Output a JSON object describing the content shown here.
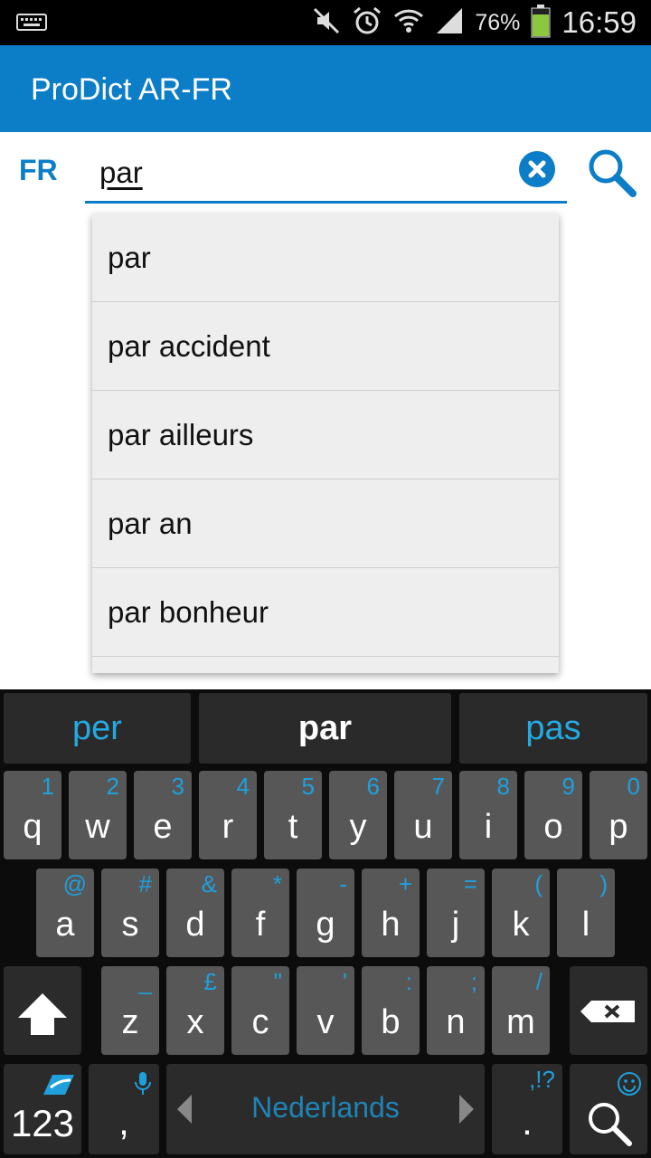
{
  "status_bar": {
    "battery_percent": "76%",
    "time": "16:59"
  },
  "app": {
    "title": "ProDict AR-FR"
  },
  "search": {
    "language": "FR",
    "value": "par"
  },
  "suggestions_dropdown": [
    "par",
    "par accident",
    "par ailleurs",
    "par an",
    "par bonheur"
  ],
  "keyboard": {
    "word_suggestions": {
      "left": "per",
      "center": "par",
      "right": "pas"
    },
    "row1": [
      {
        "key": "q",
        "hint": "1"
      },
      {
        "key": "w",
        "hint": "2"
      },
      {
        "key": "e",
        "hint": "3"
      },
      {
        "key": "r",
        "hint": "4"
      },
      {
        "key": "t",
        "hint": "5"
      },
      {
        "key": "y",
        "hint": "6"
      },
      {
        "key": "u",
        "hint": "7"
      },
      {
        "key": "i",
        "hint": "8"
      },
      {
        "key": "o",
        "hint": "9"
      },
      {
        "key": "p",
        "hint": "0"
      }
    ],
    "row2": [
      {
        "key": "a",
        "hint": "@"
      },
      {
        "key": "s",
        "hint": "#"
      },
      {
        "key": "d",
        "hint": "&"
      },
      {
        "key": "f",
        "hint": "*"
      },
      {
        "key": "g",
        "hint": "-"
      },
      {
        "key": "h",
        "hint": "+"
      },
      {
        "key": "j",
        "hint": "="
      },
      {
        "key": "k",
        "hint": "("
      },
      {
        "key": "l",
        "hint": ")"
      }
    ],
    "row3": [
      {
        "key": "z",
        "hint": "_"
      },
      {
        "key": "x",
        "hint": "£"
      },
      {
        "key": "c",
        "hint": "\""
      },
      {
        "key": "v",
        "hint": "'"
      },
      {
        "key": "b",
        "hint": ":"
      },
      {
        "key": "n",
        "hint": ";"
      },
      {
        "key": "m",
        "hint": "/"
      }
    ],
    "numbers_key": "123",
    "comma_key": ",",
    "space_language": "Nederlands",
    "period_key": ".",
    "period_hint": ",!?"
  },
  "colors": {
    "accent": "#0c7dc7",
    "keyboard_hint": "#1fa0dc"
  }
}
